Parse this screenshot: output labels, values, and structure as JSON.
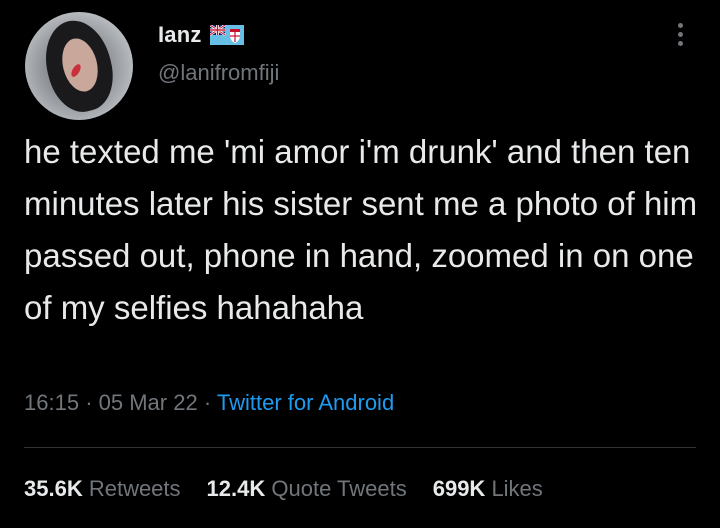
{
  "user": {
    "display_name": "Ianz",
    "handle": "@lanifromfiji",
    "avatar": "profile-photo",
    "badge_icon": "fiji-flag-icon"
  },
  "menu_icon": "more-options-icon",
  "tweet": {
    "text": "he texted me 'mi amor i'm drunk' and then ten minutes later his sister sent me a photo of him passed out, phone in hand, zoomed in on one of my selfies hahahaha",
    "time": "16:15",
    "date": "05 Mar 22",
    "separator": "·",
    "source": "Twitter for Android"
  },
  "stats": {
    "retweets_count": "35.6K",
    "retweets_label": "Retweets",
    "quotes_count": "12.4K",
    "quotes_label": "Quote Tweets",
    "likes_count": "699K",
    "likes_label": "Likes"
  },
  "colors": {
    "background": "#000000",
    "text": "#e7e9ea",
    "secondary": "#71767b",
    "link": "#1d9bf0",
    "divider": "#2f3336"
  }
}
